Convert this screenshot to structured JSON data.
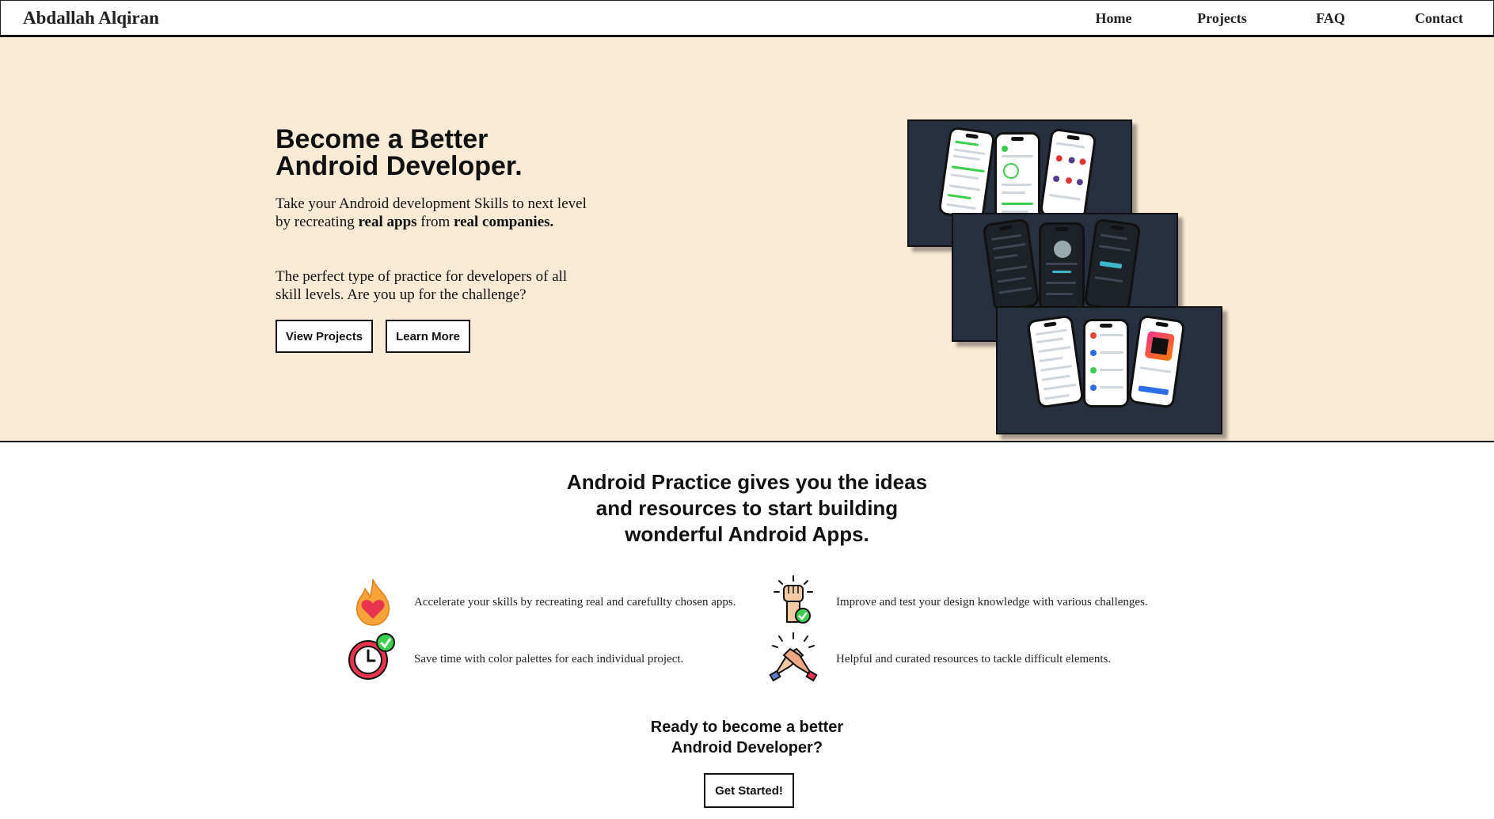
{
  "nav": {
    "brand": "Abdallah Alqiran",
    "links": [
      "Home",
      "Projects",
      "FAQ",
      "Contact"
    ]
  },
  "hero": {
    "title_line1": "Become a Better",
    "title_line2": "Android Developer.",
    "p1_a": "Take your Android development Skills to next level by recreating ",
    "p1_b": "real apps",
    "p1_c": " from ",
    "p1_d": "real companies.",
    "p2": "The perfect type of practice for developers of all skill levels. Are you up for the challenge?",
    "btn_view": "View Projects",
    "btn_learn": "Learn More"
  },
  "features": {
    "title_line1": "Android Practice gives you the ideas",
    "title_line2": "and resources to start building",
    "title_line3": "wonderful Android Apps.",
    "items": [
      {
        "text": "Accelerate your skills by recreating real and carefullty chosen apps.",
        "icon": "fire-heart-icon"
      },
      {
        "text": "Improve and test your design knowledge with various challenges.",
        "icon": "raised-fist-icon"
      },
      {
        "text": "Save time with color palettes for each individual project.",
        "icon": "clock-check-icon"
      },
      {
        "text": "Helpful and curated resources to tackle difficult elements.",
        "icon": "handshake-icon"
      }
    ]
  },
  "cta": {
    "line1": "Ready to become a better",
    "line2": "Android Developer?",
    "button": "Get Started!"
  },
  "colors": {
    "hero_bg": "#fbead6",
    "panel_bg": "#26303f",
    "accent_green": "#3ccf4e"
  }
}
